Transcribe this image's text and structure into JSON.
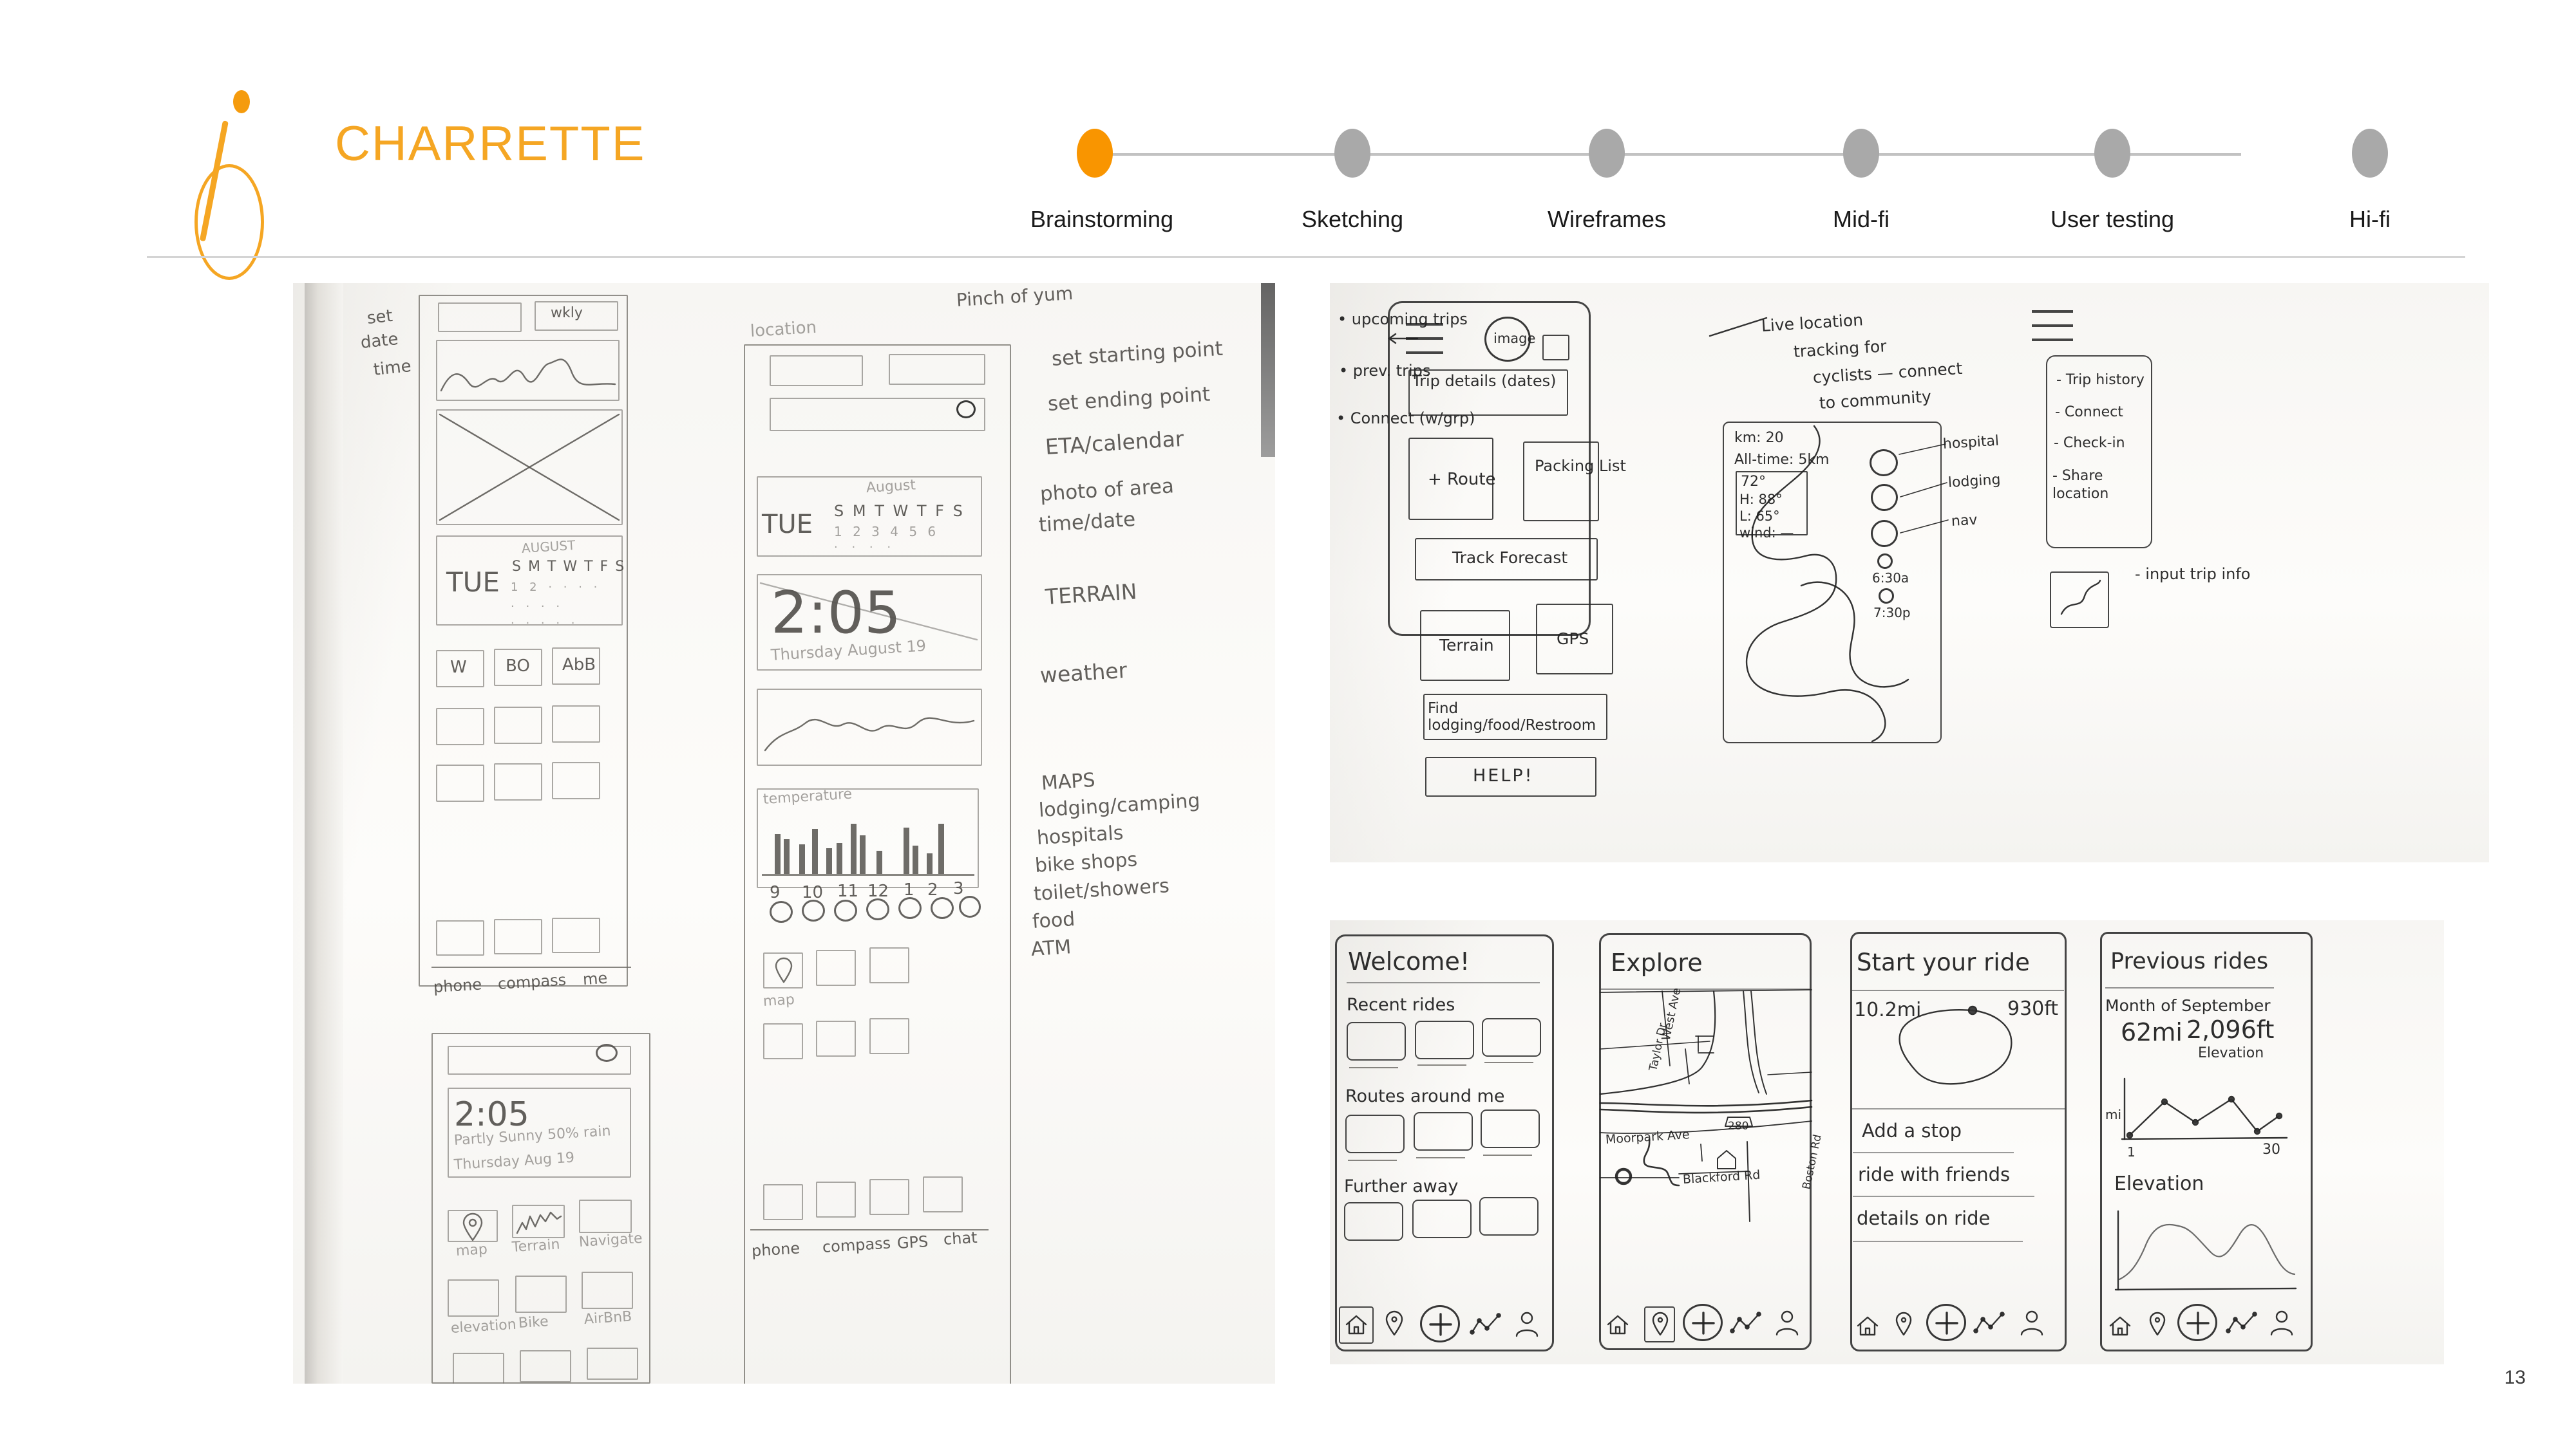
{
  "header": {
    "brand_title": "CHARRETTE",
    "logo_name": "charrette-bike-logo"
  },
  "tracker": {
    "steps": [
      {
        "label": "Brainstorming",
        "active": true
      },
      {
        "label": "Sketching",
        "active": false
      },
      {
        "label": "Wireframes",
        "active": false
      },
      {
        "label": "Mid-fi",
        "active": false
      },
      {
        "label": "User testing",
        "active": false
      },
      {
        "label": "Hi-fi",
        "active": false
      }
    ],
    "active_color": "#f99500",
    "inactive_color": "#a9a9a9"
  },
  "slide_number": "13",
  "sketch_left": {
    "caption_top": "Pinch of yum",
    "corner_note": [
      "set",
      "date",
      "time"
    ],
    "screen_a": {
      "header_right_label": "wkly",
      "calendar_day": "TUE",
      "calendar_month": "AUGUST",
      "weekday_initials": "S M T W T F S",
      "tiles": [
        "W",
        "BO",
        "AbB"
      ],
      "footer_labels": [
        "phone",
        "compass",
        "me"
      ]
    },
    "screen_b": {
      "section_label": "location",
      "calendar_day": "TUE",
      "calendar_month": "August",
      "weekday_initials": "S M T W T F S",
      "calendar_dates": "1 2 3 4 5 6",
      "clock": "2:05",
      "date_line": "Thursday August 19",
      "chart_label": "temperature",
      "hour_ticks": [
        "9",
        "10",
        "11",
        "12",
        "1",
        "2",
        "3"
      ],
      "tile_label": "map",
      "footer_labels": [
        "phone",
        "compass",
        "GPS",
        "chat"
      ]
    },
    "screen_c": {
      "clock": "2:05",
      "weather_line": "Partly Sunny 50% rain",
      "date_line": "Thursday Aug 19",
      "tile_labels_row1": [
        "map",
        "Terrain",
        "Navigate"
      ],
      "tile_labels_row2": [
        "elevation",
        "Bike",
        "AirBnB"
      ]
    },
    "feature_list": [
      "set starting point",
      "set ending point",
      "ETA/calendar",
      "photo of area",
      "time/date",
      "TERRAIN",
      "weather",
      "MAPS",
      "lodging/camping",
      "hospitals",
      "bike shops",
      "toilet/showers",
      "food",
      "ATM"
    ]
  },
  "sketch_topright": {
    "bullets": [
      "upcoming trips",
      "prev. trips",
      "Connect (w/grp)"
    ],
    "phone_screen": {
      "avatar_label": "image",
      "trip_details": "Trip details (dates)",
      "buttons": [
        "+ Route",
        "Packing List",
        "Track Forecast",
        "Terrain",
        "GPS",
        "Find lodging/food/Restroom",
        "HELP!"
      ]
    },
    "map_screen": {
      "stat_km": "km: 20",
      "stat_alltime": "All-time: 5km",
      "temp": "72°",
      "high": "H: 88°",
      "low": "L: 65°",
      "wind": "wind: —",
      "sunrise": "6:30a",
      "sunset": "7:30p",
      "pin_labels": [
        "hospital",
        "lodging",
        "nav"
      ]
    },
    "annotation": "Live location tracking for cyclists — connect to community",
    "menu_items": [
      "- Trip history",
      "- Connect",
      "- Check-in",
      "- Share location"
    ],
    "input_note": "- input trip info"
  },
  "wireframes": [
    {
      "title": "Welcome!",
      "sections": [
        "Recent rides",
        "Routes around me",
        "Further away"
      ],
      "active_tab": "home"
    },
    {
      "title": "Explore",
      "map_labels": [
        "West Ave",
        "Taylor Dr",
        "280",
        "Moorpark Ave",
        "Blackford Rd",
        "Boston Rd"
      ],
      "active_tab": "places"
    },
    {
      "title": "Start your ride",
      "distance": "10.2mi",
      "elevation": "930ft",
      "menu": [
        "Add a stop",
        "ride with friends",
        "details on ride"
      ],
      "active_tab": "none"
    },
    {
      "title": "Previous rides",
      "subtitle": "Month of September",
      "distance": "62mi",
      "elevation_value": "2,096ft",
      "elevation_caption": "Elevation",
      "chart_y_label": "mi",
      "chart_x_start": "1",
      "chart_x_end": "30",
      "chart_section_label": "Elevation",
      "active_tab": "none"
    }
  ],
  "tabbar_icons": [
    "home-icon",
    "location-pin-icon",
    "plus-icon",
    "activity-chart-icon",
    "person-icon"
  ],
  "chart_data": [
    {
      "type": "bar",
      "title": "temperature",
      "categories": [
        "9",
        "10",
        "11",
        "12",
        "1",
        "2",
        "3"
      ],
      "values": [
        62,
        45,
        70,
        40,
        78,
        36,
        74
      ],
      "xlabel": "",
      "ylabel": "",
      "grid": false
    },
    {
      "type": "line",
      "title": "Month of September",
      "x": [
        1,
        5,
        10,
        15,
        20,
        25,
        30
      ],
      "values": [
        4,
        38,
        62,
        30,
        56,
        12,
        34
      ],
      "xlabel": "",
      "ylabel": "mi",
      "xlim": [
        1,
        30
      ]
    },
    {
      "type": "area",
      "title": "Elevation",
      "x": [
        0,
        1,
        2,
        3,
        4,
        5,
        6,
        7,
        8,
        9,
        10
      ],
      "values": [
        10,
        14,
        46,
        48,
        40,
        28,
        38,
        58,
        52,
        30,
        26
      ],
      "xlabel": "",
      "ylabel": ""
    }
  ]
}
